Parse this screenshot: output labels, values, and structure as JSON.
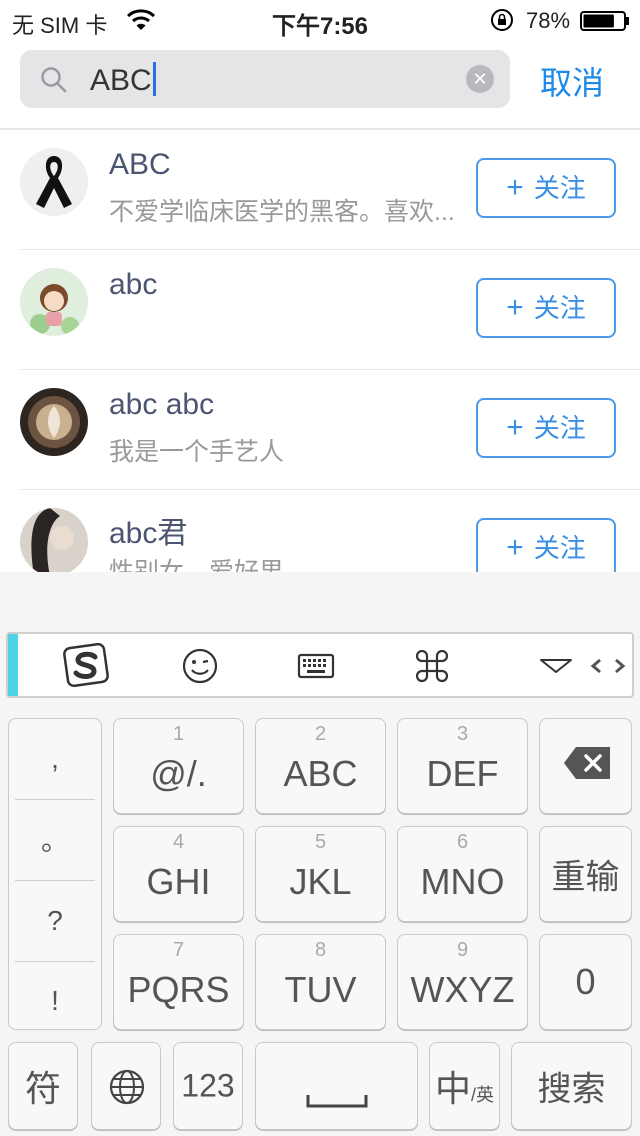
{
  "status": {
    "carrier": "无 SIM 卡",
    "time": "下午7:56",
    "battery_pct": "78%",
    "battery_level": 0.78
  },
  "search": {
    "query": "ABC",
    "cancel_label": "取消"
  },
  "results": [
    {
      "name": "ABC",
      "bio": "不爱学临床医学的黑客。喜欢...",
      "follow_label": "关注"
    },
    {
      "name": "abc",
      "bio": "",
      "follow_label": "关注"
    },
    {
      "name": "abc abc",
      "bio": "我是一个手艺人",
      "follow_label": "关注"
    },
    {
      "name": "abc君",
      "bio": "性别女，爱好男",
      "follow_label": "关注"
    }
  ],
  "keyboard": {
    "toolbar_icons": [
      "sogou-logo-icon",
      "emoji-icon",
      "keyboard-icon",
      "command-icon",
      "collapse-icon",
      "cursor-move-icon"
    ],
    "punctuation": [
      ",",
      "。",
      "?",
      "!"
    ],
    "keys": [
      {
        "num": "1",
        "label": "@/."
      },
      {
        "num": "2",
        "label": "ABC"
      },
      {
        "num": "3",
        "label": "DEF"
      },
      {
        "num": "4",
        "label": "GHI"
      },
      {
        "num": "5",
        "label": "JKL"
      },
      {
        "num": "6",
        "label": "MNO"
      },
      {
        "num": "7",
        "label": "PQRS"
      },
      {
        "num": "8",
        "label": "TUV"
      },
      {
        "num": "9",
        "label": "WXYZ"
      }
    ],
    "reinput_label": "重输",
    "zero_label": "0",
    "symbol_label": "符",
    "numbers_label": "123",
    "lang_main": "中",
    "lang_sub": "/英",
    "search_label": "搜索"
  }
}
